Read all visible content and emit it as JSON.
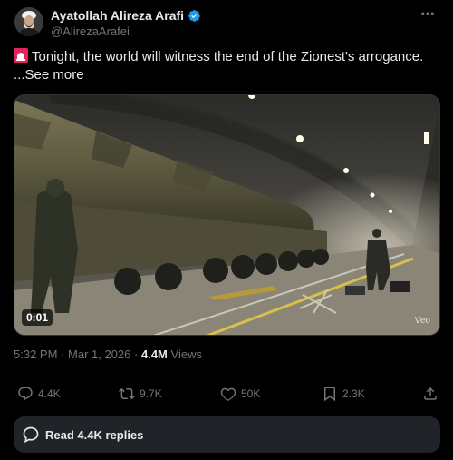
{
  "author": {
    "display_name": "Ayatollah Alireza Arafi",
    "handle": "@AlirezaArafei",
    "verified": true
  },
  "post": {
    "text": "Tonight, the world will witness the end of the Zionest's arrogance.",
    "emoji": "siren-icon",
    "see_more": "...See more"
  },
  "media": {
    "duration": "0:01",
    "watermark": "Veo"
  },
  "meta": {
    "time": "5:32 PM",
    "separator1": "·",
    "date": "Mar 1, 2026",
    "separator2": "·",
    "views_count": "4.4M",
    "views_label": "Views"
  },
  "actions": {
    "replies": "4.4K",
    "reposts": "9.7K",
    "likes": "50K",
    "bookmarks": "2.3K"
  },
  "read_replies": {
    "label": "Read 4.4K replies"
  },
  "colors": {
    "background": "#000000",
    "text": "#e7e9ea",
    "muted": "#71767b",
    "verified": "#1d9bf0",
    "button": "#202327"
  }
}
